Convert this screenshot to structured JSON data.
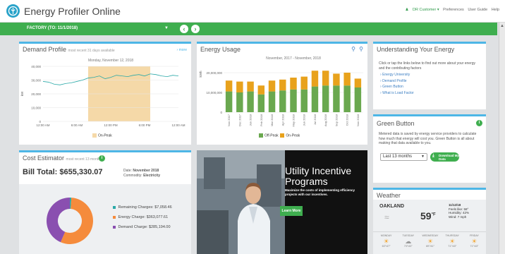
{
  "app": {
    "title": "Energy Profiler Online",
    "customer": "DR Customer",
    "links": [
      "Preferences",
      "User Guide",
      "Help"
    ]
  },
  "facility": {
    "label": "FACTORY (TO: 11/1/2018)"
  },
  "demand": {
    "title": "Demand Profile",
    "subtitle": "most recent 31 days available",
    "more": "› more",
    "date": "Monday, November 12, 2018",
    "ylabel": "kW",
    "yticks": [
      "40,000",
      "30,000",
      "20,000",
      "10,000",
      "0"
    ],
    "xticks": [
      "12:00 AM",
      "6:00 AM",
      "12:00 PM",
      "6:00 PM",
      "12:00 AM"
    ],
    "legend": "On-Peak"
  },
  "usage": {
    "title": "Energy Usage",
    "range": "November, 2017 - November, 2018",
    "ylabel": "kWh",
    "yticks": [
      "20,000,000",
      "10,000,000",
      "0"
    ],
    "legend": [
      "Off-Peak",
      "On-Peak"
    ]
  },
  "chart_data": [
    {
      "type": "line",
      "title": "Monday, November 12, 2018",
      "ylabel": "kW",
      "ylim": [
        0,
        40000
      ],
      "x": [
        "12:00 AM",
        "1:00 AM",
        "2:00 AM",
        "3:00 AM",
        "4:00 AM",
        "5:00 AM",
        "6:00 AM",
        "7:00 AM",
        "8:00 AM",
        "9:00 AM",
        "10:00 AM",
        "11:00 AM",
        "12:00 PM",
        "1:00 PM",
        "2:00 PM",
        "3:00 PM",
        "4:00 PM",
        "5:00 PM",
        "6:00 PM",
        "7:00 PM",
        "8:00 PM",
        "9:00 PM",
        "10:00 PM",
        "11:00 PM",
        "12:00 AM"
      ],
      "series": [
        {
          "values": [
            29000,
            28500,
            27000,
            26500,
            27500,
            28000,
            29000,
            30000,
            31500,
            32000,
            33000,
            31000,
            32000,
            33500,
            33000,
            32500,
            33500,
            34000,
            33000,
            34500,
            34000,
            33000,
            32500,
            33500,
            33000
          ]
        }
      ],
      "shaded_region": {
        "label": "On-Peak",
        "from": "8:00 AM",
        "to": "7:00 PM"
      }
    },
    {
      "type": "bar",
      "title": "November, 2017 - November, 2018",
      "ylabel": "kWh",
      "ylim": [
        0,
        25000000
      ],
      "categories": [
        "Nov 2017",
        "Dec 2017",
        "Jan 2018",
        "Feb 2018",
        "Mar 2018",
        "Apr 2018",
        "May 2018",
        "Jun 2018",
        "Jul 2018",
        "Aug 2018",
        "Sep 2018",
        "Oct 2018",
        "Nov 2018"
      ],
      "series": [
        {
          "name": "Off-Peak",
          "values": [
            10500000,
            10000000,
            10500000,
            9000000,
            10500000,
            11000000,
            11500000,
            11500000,
            13000000,
            13500000,
            13500000,
            13500000,
            12500000
          ]
        },
        {
          "name": "On-Peak",
          "values": [
            5500000,
            5500000,
            5000000,
            4500000,
            5500000,
            5500000,
            6000000,
            6500000,
            8000000,
            7500000,
            6000000,
            6500000,
            4500000
          ]
        }
      ]
    },
    {
      "type": "pie",
      "labels": [
        "Remaining Charges",
        "Energy Charge",
        "Demand Charge"
      ],
      "values": [
        7058.46,
        363077.61,
        285194.0
      ]
    }
  ],
  "understanding": {
    "title": "Understanding Your Energy",
    "intro": "Click or tap the links below to find out more about your energy and the contributing factors",
    "links": [
      "Energy University",
      "Demand Profile",
      "Green Button",
      "What is Load Factor"
    ]
  },
  "green": {
    "title": "Green Button",
    "text": "Metered data is saved by energy service providers to calculate how much that energy will cost you. Green Button is all about making that data available to you.",
    "select": "Last 13 months",
    "button": "Download My Data"
  },
  "cost": {
    "title": "Cost Estimator",
    "subtitle": "most recent 13 months",
    "total": "Bill Total: $655,330.07",
    "date_label": "Date:",
    "date": "November 2018",
    "commodity_label": "Commodity:",
    "commodity": "Electricity",
    "legend": [
      "Remaining Charges: $7,058.46",
      "Energy Charge: $363,077.61",
      "Demand Charge: $285,194.00"
    ]
  },
  "promo": {
    "title": "Utility Incentive Programs",
    "subtitle": "Maximize the costs of implementing efficiency projects with our incentives.",
    "button": "Learn More"
  },
  "weather": {
    "title": "Weather",
    "city": "OAKLAND",
    "date": "11/12/18",
    "temp": "59",
    "unit": "°F",
    "details": [
      "Feels like: 58°",
      "Humidity: 42%",
      "Wind: 7 mph"
    ],
    "days": [
      {
        "name": "MONDAY",
        "temps": "63°/47°"
      },
      {
        "name": "TUESDAY",
        "temps": "73°/43°"
      },
      {
        "name": "WEDNESDAY",
        "temps": "69°/41°"
      },
      {
        "name": "THURSDAY",
        "temps": "71°/43°"
      },
      {
        "name": "FRIDAY",
        "temps": "71°/43°"
      }
    ]
  },
  "colors": {
    "accent": "#4db6e6",
    "green": "#3fae4f",
    "offpeak": "#6aa84f",
    "onpeak": "#e8a21c",
    "line": "#2aa9a8",
    "shade": "#f5d9a8",
    "remaining": "#2aa9a8",
    "energy": "#f58b3c",
    "demand": "#8a4fb0"
  }
}
